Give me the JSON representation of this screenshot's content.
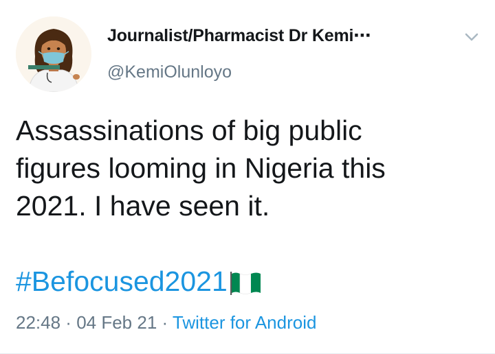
{
  "author": {
    "display_name": "Journalist/Pharmacist Dr Kemi⋯",
    "handle": "@KemiOlunloyo",
    "avatar_icon": "cartoon-woman-face-mask-avatar"
  },
  "tweet": {
    "text_lines": [
      "Assassinations of big public",
      "figures looming in Nigeria this",
      "2021. I have seen it."
    ],
    "hashtag": "#Befocused2021",
    "flag_icon": "nigeria-flag-icon"
  },
  "meta": {
    "time": "22:48",
    "separator_1": " · ",
    "date": "04 Feb 21",
    "separator_2": " · ",
    "source": "Twitter for Android"
  },
  "colors": {
    "link": "#1b95e0",
    "secondary_text": "#657786",
    "primary_text": "#14171a",
    "flag_green": "#008751"
  },
  "menu": {
    "icon": "chevron-down-icon"
  }
}
